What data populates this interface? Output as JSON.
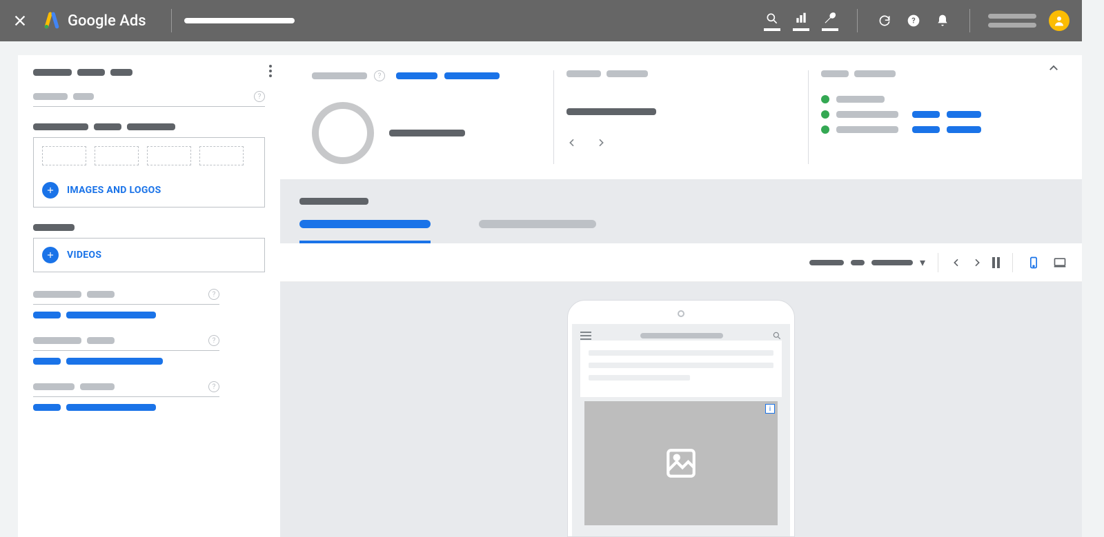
{
  "header": {
    "product_name": "Google Ads"
  },
  "left_panel": {
    "images_logos_label": "IMAGES AND LOGOS",
    "videos_label": "VIDEOS"
  },
  "preview_toolbar": {
    "dropdown_chevron": "▾"
  }
}
